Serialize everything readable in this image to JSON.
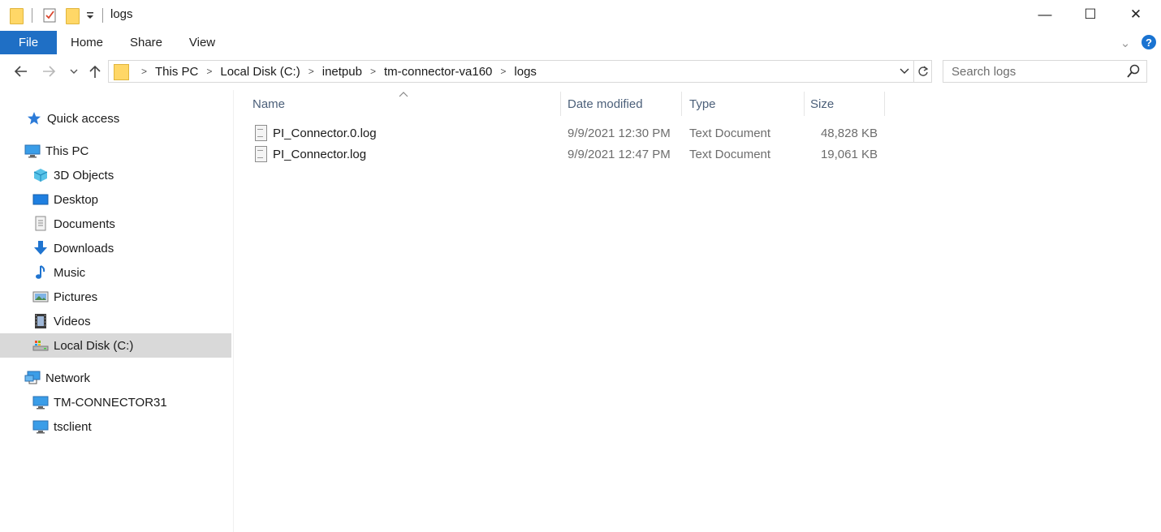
{
  "window": {
    "title": "logs",
    "controls": {
      "minimize": "—",
      "maximize": "☐",
      "close": "✕"
    }
  },
  "ribbon": {
    "tabs": [
      {
        "label": "File",
        "active": true
      },
      {
        "label": "Home"
      },
      {
        "label": "Share"
      },
      {
        "label": "View"
      }
    ],
    "help_icon": "?",
    "expand_icon": "⌄"
  },
  "address": {
    "crumbs": [
      "This PC",
      "Local Disk (C:)",
      "inetpub",
      "tm-connector-va160",
      "logs"
    ],
    "separator": ">"
  },
  "search": {
    "placeholder": "Search logs"
  },
  "nav": {
    "quick_access": "Quick access",
    "this_pc": "This PC",
    "items": [
      {
        "label": "3D Objects",
        "icon": "3d-objects-icon"
      },
      {
        "label": "Desktop",
        "icon": "desktop-icon"
      },
      {
        "label": "Documents",
        "icon": "documents-icon"
      },
      {
        "label": "Downloads",
        "icon": "downloads-icon"
      },
      {
        "label": "Music",
        "icon": "music-icon"
      },
      {
        "label": "Pictures",
        "icon": "pictures-icon"
      },
      {
        "label": "Videos",
        "icon": "videos-icon"
      },
      {
        "label": "Local Disk (C:)",
        "icon": "local-disk-icon",
        "selected": true
      }
    ],
    "network": "Network",
    "network_items": [
      {
        "label": "TM-CONNECTOR31",
        "icon": "computer-icon"
      },
      {
        "label": "tsclient",
        "icon": "computer-icon"
      }
    ]
  },
  "columns": {
    "name": "Name",
    "date": "Date modified",
    "type": "Type",
    "size": "Size"
  },
  "files": [
    {
      "name": "PI_Connector.0.log",
      "date": "9/9/2021 12:30 PM",
      "type": "Text Document",
      "size": "48,828 KB"
    },
    {
      "name": "PI_Connector.log",
      "date": "9/9/2021 12:47 PM",
      "type": "Text Document",
      "size": "19,061 KB"
    }
  ],
  "colors": {
    "file_tab": "#1f6fc5",
    "selected_nav": "#d9d9d9",
    "column_header": "#4c607a",
    "folder": "#ffd767"
  }
}
